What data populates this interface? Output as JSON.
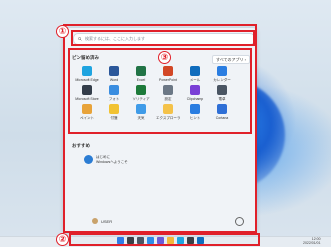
{
  "search": {
    "placeholder": "検索するには、ここに入力します"
  },
  "start_menu": {
    "pinned_title": "ピン留め済み",
    "all_apps_label": "すべてのアプリ ›",
    "apps": [
      {
        "label": "Microsoft Edge",
        "icon": "edge-icon",
        "color": "#1fa4e0"
      },
      {
        "label": "Word",
        "icon": "word-icon",
        "color": "#2b579a"
      },
      {
        "label": "Excel",
        "icon": "excel-icon",
        "color": "#217346"
      },
      {
        "label": "PowerPoint",
        "icon": "powerpoint-icon",
        "color": "#d24726"
      },
      {
        "label": "メール",
        "icon": "mail-icon",
        "color": "#0f6cbd"
      },
      {
        "label": "カレンダー",
        "icon": "calendar-icon",
        "color": "#2a7de1"
      },
      {
        "label": "Microsoft Store",
        "icon": "store-icon",
        "color": "#333d4a"
      },
      {
        "label": "フォト",
        "icon": "photos-icon",
        "color": "#3a8de0"
      },
      {
        "label": "ソリティア",
        "icon": "solitaire-icon",
        "color": "#1d7a3a"
      },
      {
        "label": "設定",
        "icon": "settings-icon",
        "color": "#6b7785"
      },
      {
        "label": "Clipchamp",
        "icon": "clipchamp-icon",
        "color": "#7a3fd6"
      },
      {
        "label": "電卓",
        "icon": "calculator-icon",
        "color": "#4a5563"
      },
      {
        "label": "ペイント",
        "icon": "paint-icon",
        "color": "#e8a33a"
      },
      {
        "label": "付箋",
        "icon": "sticky-notes-icon",
        "color": "#f1c232"
      },
      {
        "label": "天気",
        "icon": "weather-icon",
        "color": "#3f9be8"
      },
      {
        "label": "エクスプローラー",
        "icon": "explorer-icon",
        "color": "#f4c24a"
      },
      {
        "label": "ヒント",
        "icon": "tips-icon",
        "color": "#2a7de1"
      },
      {
        "label": "Cortana",
        "icon": "cortana-icon",
        "color": "#2f6fd6"
      }
    ],
    "recommended_title": "おすすめ",
    "recommended": [
      {
        "name": "はじめに",
        "desc": "Windowsへようこそ"
      }
    ],
    "user_name": "USER"
  },
  "callouts": {
    "one": "①",
    "two": "②",
    "three": "③"
  },
  "taskbar": {
    "time": "12:00",
    "date": "2022/01/01",
    "icons": [
      {
        "icon": "start-icon",
        "color": "#2f7be6"
      },
      {
        "icon": "search-icon",
        "color": "#3a3f46"
      },
      {
        "icon": "task-view-icon",
        "color": "#4a5563"
      },
      {
        "icon": "widgets-icon",
        "color": "#2d8be8"
      },
      {
        "icon": "chat-icon",
        "color": "#6a5ad8"
      },
      {
        "icon": "explorer-icon",
        "color": "#f2b83a"
      },
      {
        "icon": "edge-icon",
        "color": "#1fa4e0"
      },
      {
        "icon": "store-icon",
        "color": "#3a3f46"
      },
      {
        "icon": "mail-icon",
        "color": "#0f6cbd"
      }
    ]
  }
}
